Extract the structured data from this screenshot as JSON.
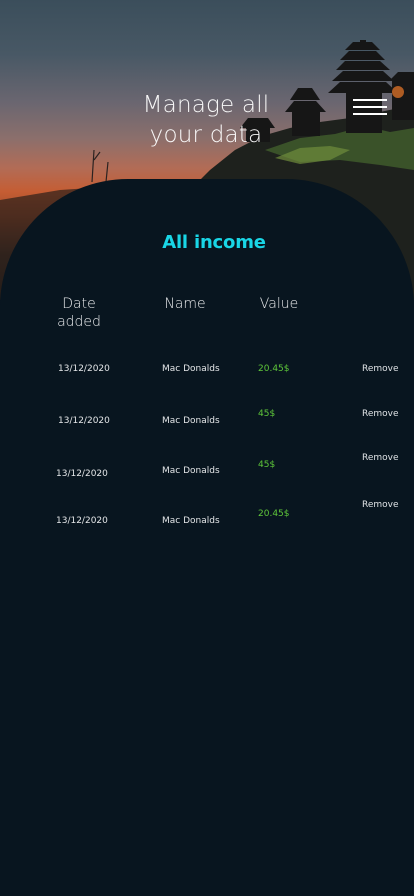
{
  "header": {
    "title": "Manage all your data"
  },
  "menu": {
    "icon": "hamburger-menu-icon"
  },
  "section": {
    "title": "All income",
    "accent_color": "#19d6e6"
  },
  "table": {
    "columns": [
      "Date added",
      "Name",
      "Value"
    ],
    "value_color": "#5ec63a",
    "rows": [
      {
        "date": "13/12/2020",
        "name": "Mac Donalds",
        "value": "20.45$",
        "action": "Remove"
      },
      {
        "date": "13/12/2020",
        "name": "Mac Donalds",
        "value": "45$",
        "action": "Remove"
      },
      {
        "date": "13/12/2020",
        "name": "Mac Donalds",
        "value": "45$",
        "action": "Remove"
      },
      {
        "date": "13/12/2020",
        "name": "Mac Donalds",
        "value": "20.45$",
        "action": "Remove"
      }
    ]
  }
}
